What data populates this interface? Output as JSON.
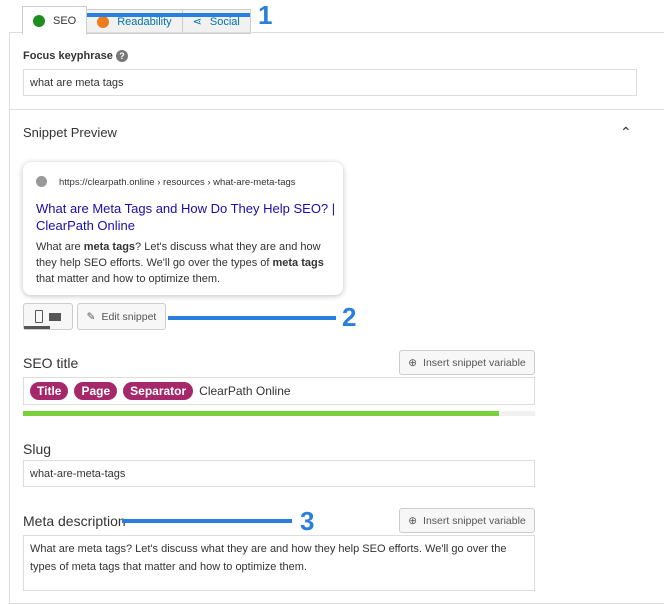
{
  "tabs": [
    {
      "label": "SEO",
      "color": "#1e8e1e"
    },
    {
      "label": "Readability",
      "color": "#ee7c1b"
    },
    {
      "label": "Social"
    }
  ],
  "focus": {
    "label": "Focus keyphrase",
    "value": "what are meta tags"
  },
  "snippet": {
    "heading": "Snippet Preview",
    "url": "https://clearpath.online › resources › what-are-meta-tags",
    "title": "What are Meta Tags and How Do They Help SEO? | ClearPath Online",
    "desc_parts": [
      "What are ",
      "meta tags",
      "? Let's discuss what they are and how they help SEO efforts. We'll go over the types of ",
      "meta tags",
      " that matter and how to optimize them."
    ],
    "edit": "Edit snippet"
  },
  "seo_title": {
    "label": "SEO title",
    "insert": "Insert snippet variable",
    "pills": [
      "Title",
      "Page",
      "Separator"
    ],
    "text": "ClearPath Online",
    "progress": 0.93,
    "progress_color": "#7ad03a"
  },
  "slug": {
    "label": "Slug",
    "value": "what-are-meta-tags"
  },
  "meta": {
    "label": "Meta description",
    "insert": "Insert snippet variable",
    "value": "What are meta tags? Let's discuss what they are and how they help SEO efforts. We'll go over the types of meta tags that matter and how to optimize them."
  },
  "annotations": [
    "1",
    "2",
    "3"
  ],
  "accent": "#2a7fdc"
}
